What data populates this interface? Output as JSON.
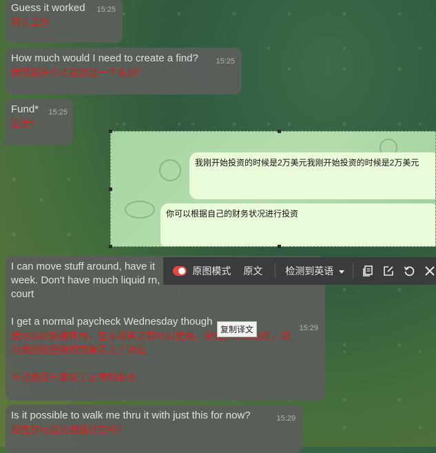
{
  "messages": [
    {
      "original": "Guess it worked",
      "translated": "猜它工作",
      "time": "15:25"
    },
    {
      "original": "How much would I need to create a find?",
      "translated": "我需要多少才能创建一个发现？",
      "time": "15:25"
    },
    {
      "original": "Fund*",
      "translated": "基金*",
      "time": "15:25"
    },
    {
      "original_lines": [
        "I can move stuff around, have it",
        "week. Don't have much liquid rn,",
        "court",
        "",
        "I get a normal paycheck Wednesday though"
      ],
      "translated_lines": [
        "我可以四处搬东西，在本周末之前可以使用。没有多少流动性，因",
        "为我刚刚把我的前妻告上了法庭",
        "",
        "不过我周三拿到了正常的薪水"
      ],
      "time": "15:29"
    },
    {
      "original": "Is it possible to walk me thru it with just this for now?",
      "translated": "现在有可能让我通过它吗？",
      "time": "15:29"
    }
  ],
  "overlay": {
    "bubble1": "我刚开始投资的时候是2万美元我刚开始投资的时候是2万美元",
    "bubble2": "你可以根据自己的财务状况进行投资"
  },
  "toolbar": {
    "mode_label": "原图模式",
    "original_label": "原文",
    "detect_label": "检测到英语",
    "mode_on": true
  },
  "tooltip": "复制译文",
  "colors": {
    "translation": "#d81e1e",
    "accent_toggle": "#f0433a"
  }
}
